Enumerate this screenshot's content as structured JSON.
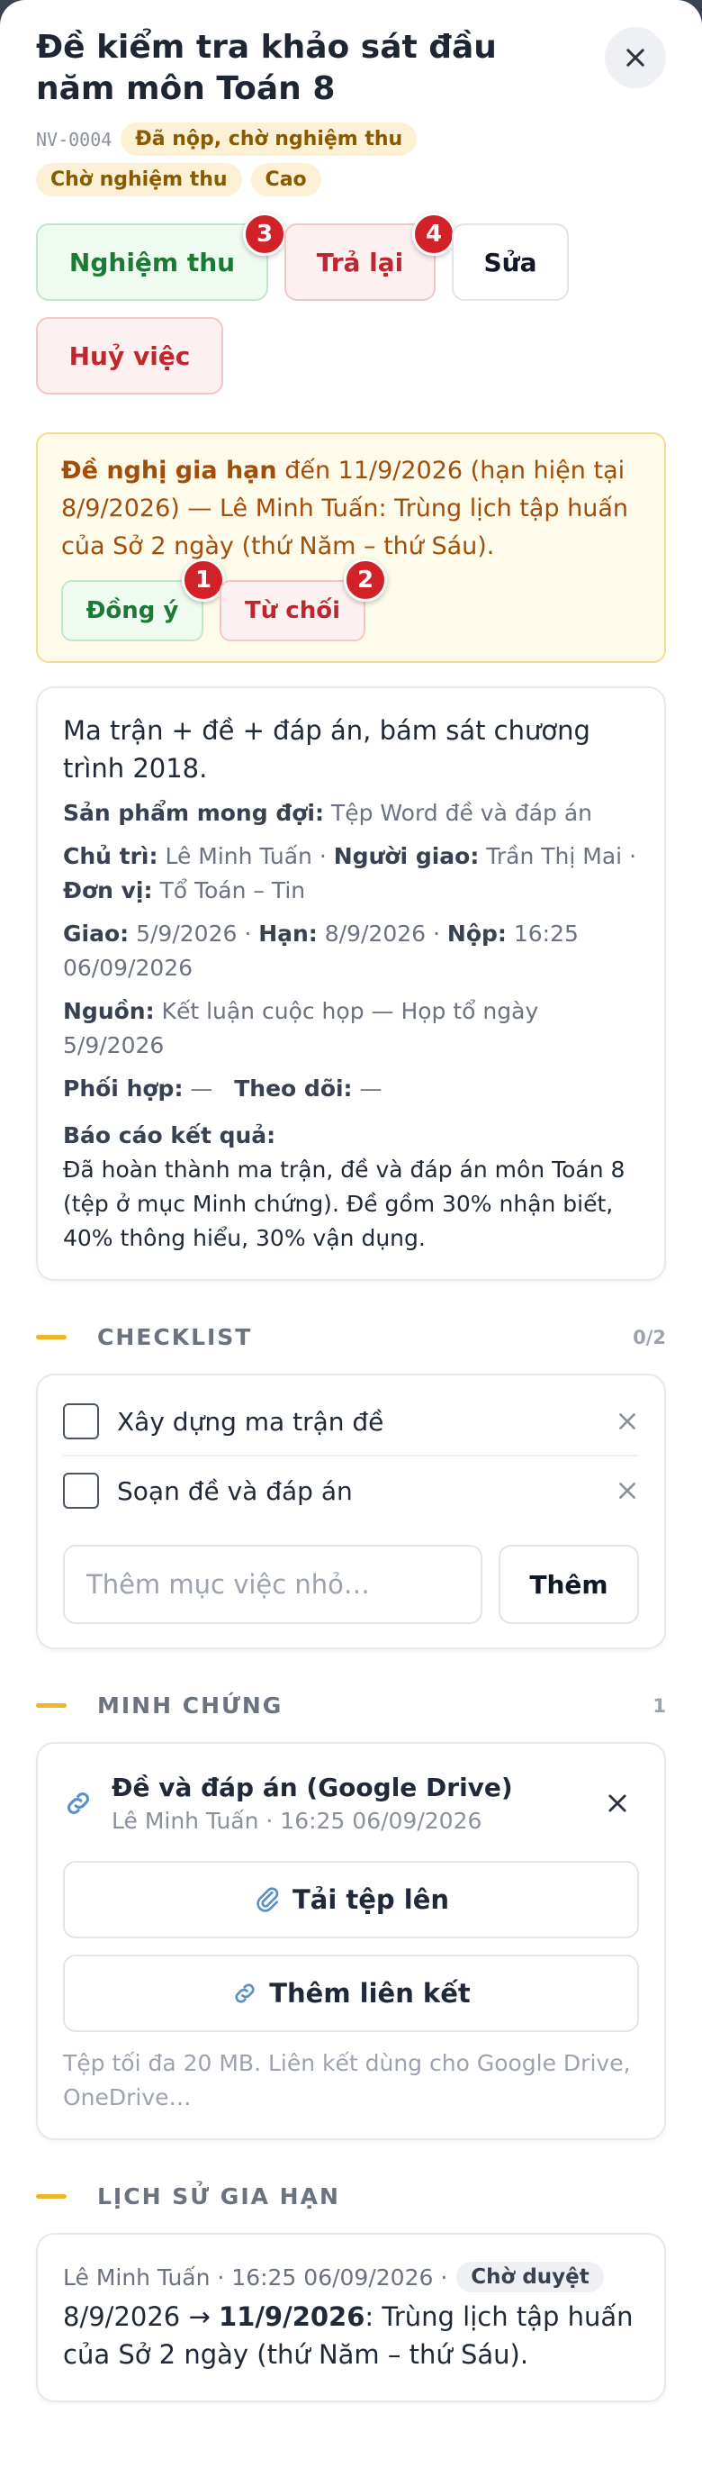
{
  "task": {
    "title": "Đề kiểm tra khảo sát đầu năm môn Toán 8",
    "code": "NV-0004",
    "chips": [
      "Đã nộp, chờ nghiệm thu",
      "Chờ nghiệm thu",
      "Cao"
    ]
  },
  "actions": {
    "accept": "Nghiệm thu",
    "accept_badge": "3",
    "return": "Trả lại",
    "return_badge": "4",
    "edit": "Sửa",
    "cancel": "Huỷ việc"
  },
  "extension": {
    "heading": "Đề nghị gia hạn",
    "body": " đến 11/9/2026 (hạn hiện tại 8/9/2026) — Lê Minh Tuấn: Trùng lịch tập huấn của Sở 2 ngày (thứ Năm – thứ Sáu).",
    "approve": "Đồng ý",
    "approve_badge": "1",
    "reject": "Từ chối",
    "reject_badge": "2"
  },
  "details": {
    "description": "Ma trận + đề + đáp án, bám sát chương trình 2018.",
    "expected_label": "Sản phẩm mong đợi:",
    "expected_value": "Tệp Word đề và đáp án",
    "owner_label": "Chủ trì:",
    "owner_value": "Lê Minh Tuấn",
    "assigner_label": "Người giao:",
    "assigner_value": "Trần Thị Mai",
    "unit_label": "Đơn vị:",
    "unit_value": "Tổ Toán – Tin",
    "assigned_label": "Giao:",
    "assigned_value": "5/9/2026",
    "due_label": "Hạn:",
    "due_value": "8/9/2026",
    "submitted_label": "Nộp:",
    "submitted_value": "16:25 06/09/2026",
    "source_label": "Nguồn:",
    "source_value": "Kết luận cuộc họp — Họp tổ ngày 5/9/2026",
    "collab_label": "Phối hợp:",
    "collab_value": "—",
    "watch_label": "Theo dõi:",
    "watch_value": "—",
    "report_label": "Báo cáo kết quả:",
    "report_value": "Đã hoàn thành ma trận, đề và đáp án môn Toán 8 (tệp ở mục Minh chứng). Đề gồm 30% nhận biết, 40% thông hiểu, 30% vận dụng."
  },
  "checklist": {
    "title": "CHECKLIST",
    "count": "0/2",
    "items": [
      {
        "label": "Xây dựng ma trận đề",
        "checked": false
      },
      {
        "label": "Soạn đề và đáp án",
        "checked": false
      }
    ],
    "input_placeholder": "Thêm mục việc nhỏ…",
    "add_label": "Thêm"
  },
  "evidence": {
    "title": "MINH CHỨNG",
    "count": "1",
    "files": [
      {
        "name": "Đề và đáp án (Google Drive)",
        "meta": "Lê Minh Tuấn · 16:25 06/09/2026",
        "icon": "link-icon"
      }
    ],
    "upload_label": "Tải tệp lên",
    "link_label": "Thêm liên kết",
    "hint": "Tệp tối đa 20 MB. Liên kết dùng cho Google Drive, OneDrive…"
  },
  "history": {
    "title": "LỊCH SỬ GIA HẠN",
    "entries": [
      {
        "meta": "Lê Minh Tuấn · 16:25 06/09/2026 ·",
        "status": "Chờ duyệt",
        "from": "8/9/2026 → ",
        "to": "11/9/2026",
        "reason": ": Trùng lịch tập huấn của Sở 2 ngày (thứ Năm – thứ Sáu)."
      }
    ]
  },
  "colors": {
    "accent_yellow": "#f0b429",
    "green": "#1b7a33",
    "red": "#c0262d",
    "badge_red": "#d1222a"
  }
}
